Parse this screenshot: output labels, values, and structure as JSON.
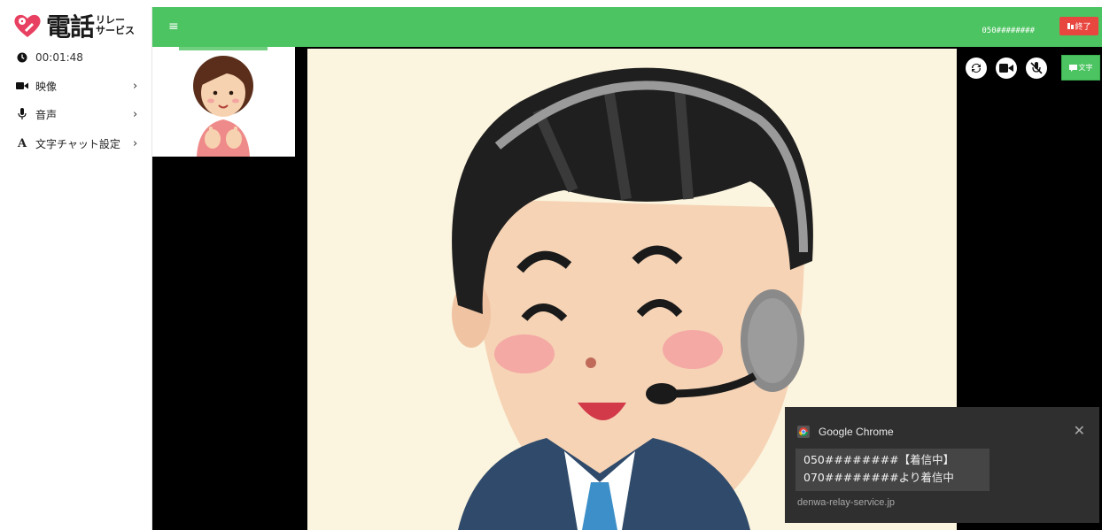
{
  "app": {
    "logo_text": "電話",
    "logo_sub_top": "リレー",
    "logo_sub_bottom": "サービス"
  },
  "sidebar": {
    "timer": "00:01:48",
    "items": [
      {
        "label": "映像",
        "icon": "video-camera-icon"
      },
      {
        "label": "音声",
        "icon": "microphone-icon"
      },
      {
        "label": "文字チャット設定",
        "icon": "text-a-icon"
      }
    ]
  },
  "topbar": {
    "menu_icon": "≡",
    "phone_number": "050########",
    "end_label": "終了"
  },
  "controls": {
    "chat_label": "文字",
    "icons": [
      "refresh-icon",
      "video-camera-icon",
      "microphone-muted-icon",
      "chat-icon"
    ]
  },
  "notification": {
    "app_name": "Google Chrome",
    "line1": "050########【着信中】",
    "line2": "070########より着信中",
    "source": "denwa-relay-service.jp",
    "close": "✕"
  },
  "colors": {
    "accent_green": "#4cc461",
    "end_red": "#e8473f",
    "logo_pink": "#e84060"
  }
}
